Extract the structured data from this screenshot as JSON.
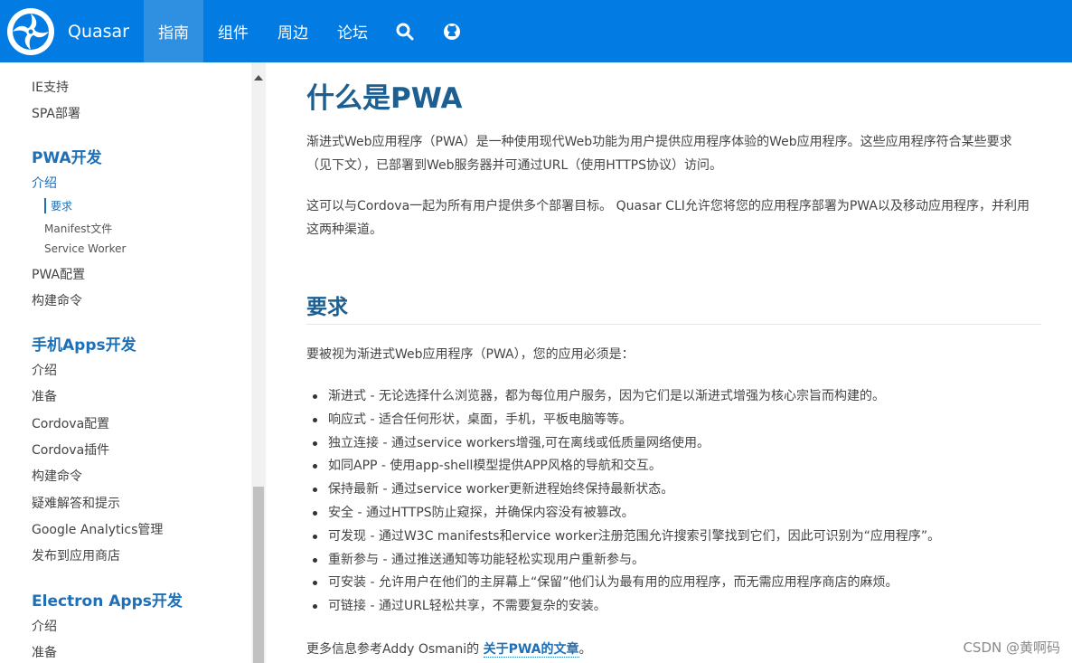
{
  "header": {
    "brand": "Quasar",
    "nav": [
      "指南",
      "组件",
      "周边",
      "论坛"
    ],
    "active_nav": "指南",
    "icons": [
      "search-icon",
      "github-icon"
    ],
    "color": "#027be3"
  },
  "sidebar": {
    "items_top": [
      "IE支持",
      "SPA部署"
    ],
    "pwa": {
      "heading": "PWA开发",
      "intro": "介绍",
      "sub": [
        "要求",
        "Manifest文件",
        "Service Worker"
      ],
      "more": [
        "PWA配置",
        "构建命令"
      ]
    },
    "mobile": {
      "heading": "手机Apps开发",
      "items": [
        "介绍",
        "准备",
        "Cordova配置",
        "Cordova插件",
        "构建命令",
        "疑难解答和提示",
        "Google Analytics管理",
        "发布到应用商店"
      ]
    },
    "electron": {
      "heading": "Electron Apps开发",
      "items": [
        "介绍",
        "准备"
      ]
    }
  },
  "content": {
    "title": "什么是PWA",
    "para1": "渐进式Web应用程序（PWA）是一种使用现代Web功能为用户提供应用程序体验的Web应用程序。这些应用程序符合某些要求（见下文），已部署到Web服务器并可通过URL（使用HTTPS协议）访问。",
    "para2": "这可以与Cordova一起为所有用户提供多个部署目标。 Quasar CLI允许您将您的应用程序部署为PWA以及移动应用程序，并利用这两种渠道。",
    "section_title": "要求",
    "req_intro": "要被视为渐进式Web应用程序（PWA），您的应用必须是：",
    "requirements": [
      "渐进式 - 无论选择什么浏览器，都为每位用户服务，因为它们是以渐进式增强为核心宗旨而构建的。",
      "响应式 - 适合任何形状，桌面，手机，平板电脑等等。",
      "独立连接 - 通过service workers增强,可在离线或低质量网络使用。",
      "如同APP - 使用app-shell模型提供APP风格的导航和交互。",
      "保持最新 - 通过service worker更新进程始终保持最新状态。",
      "安全 - 通过HTTPS防止窥探，并确保内容没有被篡改。",
      "可发现 - 通过W3C manifests和ervice worker注册范围允许搜索引擎找到它们，因此可识别为“应用程序”。",
      "重新参与 - 通过推送通知等功能轻松实现用户重新参与。",
      "可安装 - 允许用户在他们的主屏幕上“保留”他们认为最有用的应用程序，而无需应用程序商店的麻烦。",
      "可链接 - 通过URL轻松共享，不需要复杂的安装。"
    ],
    "more_prefix": "更多信息参考Addy Osmani的 ",
    "more_link": "关于PWA的文章",
    "more_suffix": "。"
  },
  "watermark": "CSDN @黄啊码"
}
